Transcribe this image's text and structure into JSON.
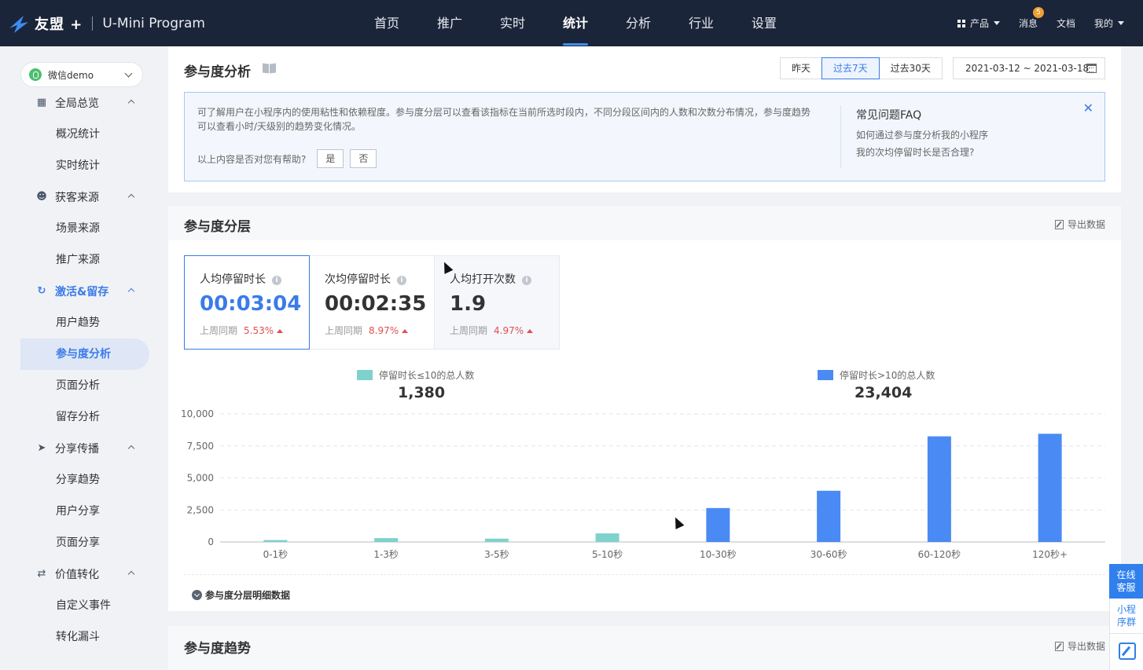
{
  "header": {
    "brand": "友盟 +",
    "product": "U-Mini Program",
    "nav": [
      "首页",
      "推广",
      "实时",
      "统计",
      "分析",
      "行业",
      "设置"
    ],
    "active_nav": 3,
    "right": {
      "products": "产品",
      "messages": "消息",
      "message_count": "5",
      "docs": "文档",
      "mine": "我的"
    }
  },
  "sidebar": {
    "app_name": "微信demo",
    "groups": [
      {
        "label": "全局总览",
        "icon": "grid-icon",
        "items": [
          "概况统计",
          "实时统计"
        ]
      },
      {
        "label": "获客来源",
        "icon": "users-icon",
        "items": [
          "场景来源",
          "推广来源"
        ]
      },
      {
        "label": "激活&留存",
        "icon": "activation-icon",
        "items": [
          "用户趋势",
          "参与度分析",
          "页面分析",
          "留存分析"
        ],
        "active": true
      },
      {
        "label": "分享传播",
        "icon": "send-icon",
        "items": [
          "分享趋势",
          "用户分享",
          "页面分享"
        ]
      },
      {
        "label": "价值转化",
        "icon": "convert-icon",
        "items": [
          "自定义事件",
          "转化漏斗"
        ]
      }
    ],
    "active_item": "参与度分析"
  },
  "overview": {
    "title": "参与度分析",
    "ranges": [
      "昨天",
      "过去7天",
      "过去30天"
    ],
    "selected_range": "过去7天",
    "date_range": "2021-03-12 ~ 2021-03-18",
    "info_text": "可了解用户在小程序内的使用粘性和依赖程度。参与度分层可以查看该指标在当前所选时段内，不同分段区间内的人数和次数分布情况，参与度趋势可以查看小时/天级别的趋势变化情况。",
    "helpful_question": "以上内容是否对您有帮助?",
    "yes": "是",
    "no": "否",
    "faq_title": "常见问题FAQ",
    "faq_items": [
      "如何通过参与度分析我的小程序",
      "我的次均停留时长是否合理?"
    ],
    "close": "✕"
  },
  "layer": {
    "title": "参与度分层",
    "export": "导出数据",
    "cards": [
      {
        "label": "人均停留时长",
        "value": "00:03:04",
        "cmp_label": "上周同期",
        "cmp_value": "5.53%"
      },
      {
        "label": "次均停留时长",
        "value": "00:02:35",
        "cmp_label": "上周同期",
        "cmp_value": "8.97%"
      },
      {
        "label": "人均打开次数",
        "value": "1.9",
        "cmp_label": "上周同期",
        "cmp_value": "4.97%"
      }
    ],
    "detail_toggle": "参与度分层明细数据"
  },
  "chart_data": {
    "type": "bar",
    "categories": [
      "0-1秒",
      "1-3秒",
      "3-5秒",
      "5-10秒",
      "10-30秒",
      "30-60秒",
      "60-120秒",
      "120秒+"
    ],
    "series": [
      {
        "name": "停留时长≤10的总人数",
        "total": "1,380",
        "color": "#7fd1cc",
        "values": [
          150,
          300,
          260,
          670,
          0,
          0,
          0,
          0
        ]
      },
      {
        "name": "停留时长>10的总人数",
        "total": "23,404",
        "color": "#4a8af4",
        "values": [
          0,
          0,
          0,
          0,
          2650,
          4000,
          8250,
          8450
        ]
      }
    ],
    "yticks": [
      "0",
      "2,500",
      "5,000",
      "7,500",
      "10,000"
    ],
    "ylim": [
      0,
      10000
    ],
    "grid": true,
    "legend": "top"
  },
  "trend": {
    "title": "参与度趋势",
    "export": "导出数据"
  },
  "floating": {
    "service": "在线客服",
    "group": "小程序群"
  }
}
